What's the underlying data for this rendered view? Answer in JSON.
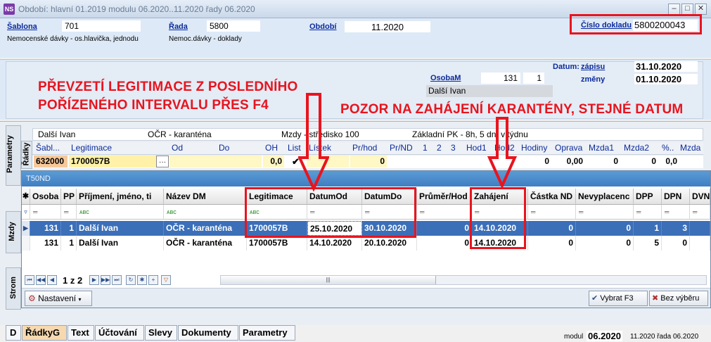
{
  "window": {
    "title": "Období: hlavní 01.2019 modulu 06.2020..11.2020 řady 06.2020",
    "app_icon": "NS"
  },
  "header": {
    "sablona_label": "Šablona",
    "sablona_value": "701",
    "sablona_desc": "Nemocenské dávky - os.hlavička, jednodu",
    "rada_label": "Řada",
    "rada_value": "5800",
    "rada_desc": "Nemoc.dávky - doklady",
    "obdobi_label": "Období",
    "obdobi_value": "11.2020",
    "cislo_label": "Číslo dokladu",
    "cislo_value": "5800200043"
  },
  "info": {
    "osoba_label": "OsobaM",
    "osoba_value": "131",
    "osoba_pp": "1",
    "osoba_name": "Další Ivan",
    "datum_label": "Datum:",
    "zapisu_label": "zápisu",
    "zapisu_value": "31.10.2020",
    "zmeny_label": "změny",
    "zmeny_value": "01.10.2020"
  },
  "annotations": {
    "left_line1": "PŘEVZETÍ LEGITIMACE Z POSLEDNÍHO",
    "left_line2": "POŘÍZENÉHO INTERVALU PŘES F4",
    "right": "POZOR NA ZAHÁJENÍ KARANTÉNY, STEJNÉ DATUM"
  },
  "vtabs": {
    "parametry": "Parametry",
    "radky": "Řádky",
    "mzdy": "Mzdy",
    "strom": "Strom"
  },
  "summary_row": {
    "name": "Další Ivan",
    "dm": "OČR - karanténa",
    "mzdy": "Mzdy - středisko 100",
    "pk": "Základní PK - 8h, 5 dní v týdnu"
  },
  "back_grid": {
    "headers": [
      "Šabl...",
      "Legitimace",
      "Od",
      "Do",
      "OH",
      "List",
      "Lístek",
      "Pr/hod",
      "Pr/ND",
      "1",
      "2",
      "3",
      "Hod1",
      "Hod2",
      "Hodiny",
      "Oprava",
      "Mzda1",
      "Mzda2",
      "%..",
      "Mzda"
    ],
    "row": {
      "sabl": "632000",
      "legit": "1700057B",
      "dots": "···",
      "oh": "0,0",
      "check": "✔",
      "prhod": "0",
      "hodiny": "0",
      "oprava": "0,00",
      "mzda1": "0",
      "mzda2": "0",
      "pct": "0,0"
    }
  },
  "dialog": {
    "title": "T50ND",
    "columns": [
      "Osoba",
      "PP",
      "Příjmení, jméno, ti",
      "Název DM",
      "Legitimace",
      "DatumOd",
      "DatumDo",
      "Průměr/Hod",
      "Zahájení",
      "Částka ND",
      "Nevyplacenc",
      "DPP",
      "DPN",
      "DVN"
    ],
    "filter_text": "═",
    "filter_abc": "ᴀʙᴄ",
    "rows": [
      {
        "osoba": "131",
        "pp": "1",
        "jmeno": "Další Ivan",
        "dm": "OČR - karanténa",
        "legit": "1700057B",
        "od": "25.10.2020",
        "do": "30.10.2020",
        "prumer": "0",
        "zahajeni": "14.10.2020",
        "castka": "0",
        "nevypl": "0",
        "dpp": "1",
        "dpn": "3"
      },
      {
        "osoba": "131",
        "pp": "1",
        "jmeno": "Další Ivan",
        "dm": "OČR - karanténa",
        "legit": "1700057B",
        "od": "14.10.2020",
        "do": "20.10.2020",
        "prumer": "0",
        "zahajeni": "14.10.2020",
        "castka": "0",
        "nevypl": "0",
        "dpp": "5",
        "dpn": "0"
      }
    ],
    "pager": "1 z 2",
    "nastaveni": "Nastavení",
    "vybrat": "Vybrat F3",
    "bez": "Bez výběru"
  },
  "bottom_tabs": [
    "D",
    "ŘádkyG",
    "Text",
    "Účtování",
    "Slevy",
    "Dokumenty",
    "Parametry"
  ],
  "status": {
    "modul_label": "modul",
    "modul_value": "06.2020",
    "rest": "11.2020 řada 06.2020"
  },
  "colors": {
    "accent_red": "#e8141e",
    "selection": "#3b6fb8",
    "label_blue": "#0b2a9a"
  }
}
